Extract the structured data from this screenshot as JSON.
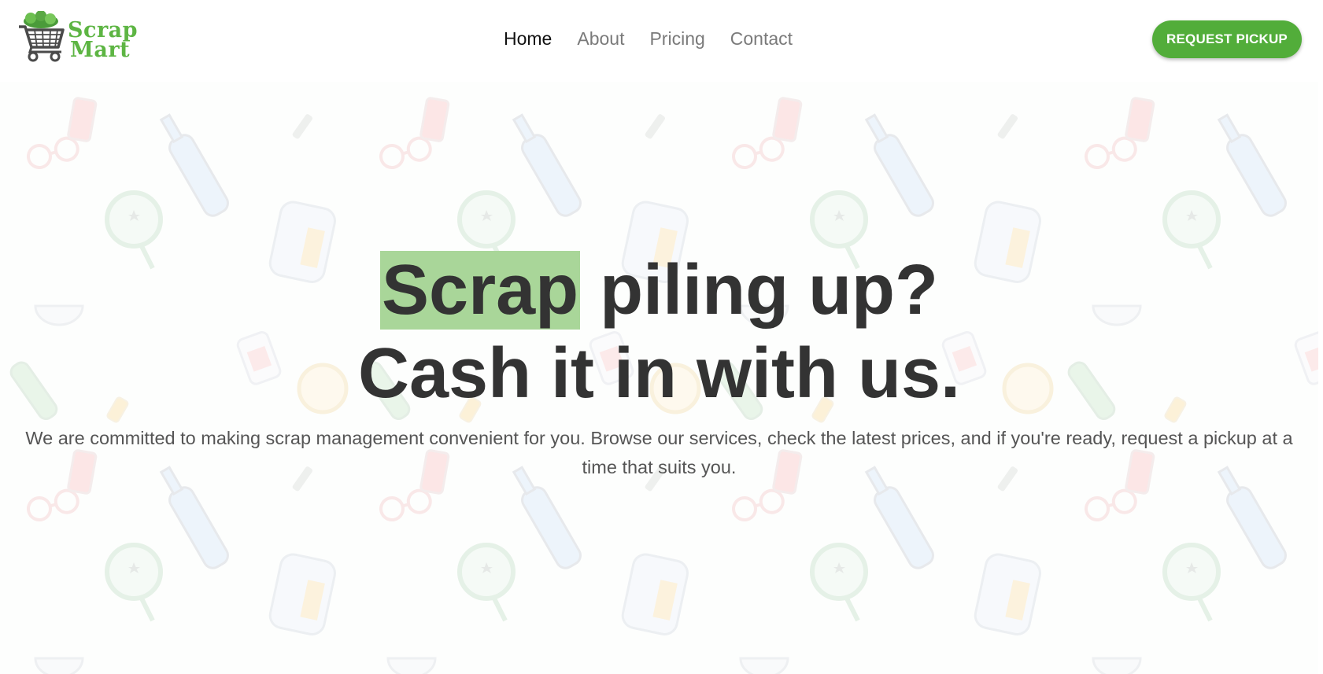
{
  "brand": {
    "name_line1": "Scrap",
    "name_line2": "Mart",
    "logo_icon": "shopping-cart-icon",
    "color": "#5db543"
  },
  "nav": {
    "items": [
      {
        "label": "Home",
        "active": true
      },
      {
        "label": "About",
        "active": false
      },
      {
        "label": "Pricing",
        "active": false
      },
      {
        "label": "Contact",
        "active": false
      }
    ]
  },
  "cta": {
    "label": "REQUEST PICKUP",
    "color": "#52ad3a"
  },
  "hero": {
    "headline_highlight": "Scrap",
    "headline_rest": " piling up?",
    "headline_line2": "Cash it in with us.",
    "highlight_color": "#a9d699",
    "subtext": "We are committed to making scrap management convenient for you. Browse our services, check the latest prices, and if you're ready, request a pickup at a time that suits you.",
    "background_icons": [
      "bottle-icon",
      "jar-icon",
      "magnifier-icon",
      "glasses-icon",
      "bowl-icon",
      "battery-icon",
      "cup-icon"
    ]
  }
}
